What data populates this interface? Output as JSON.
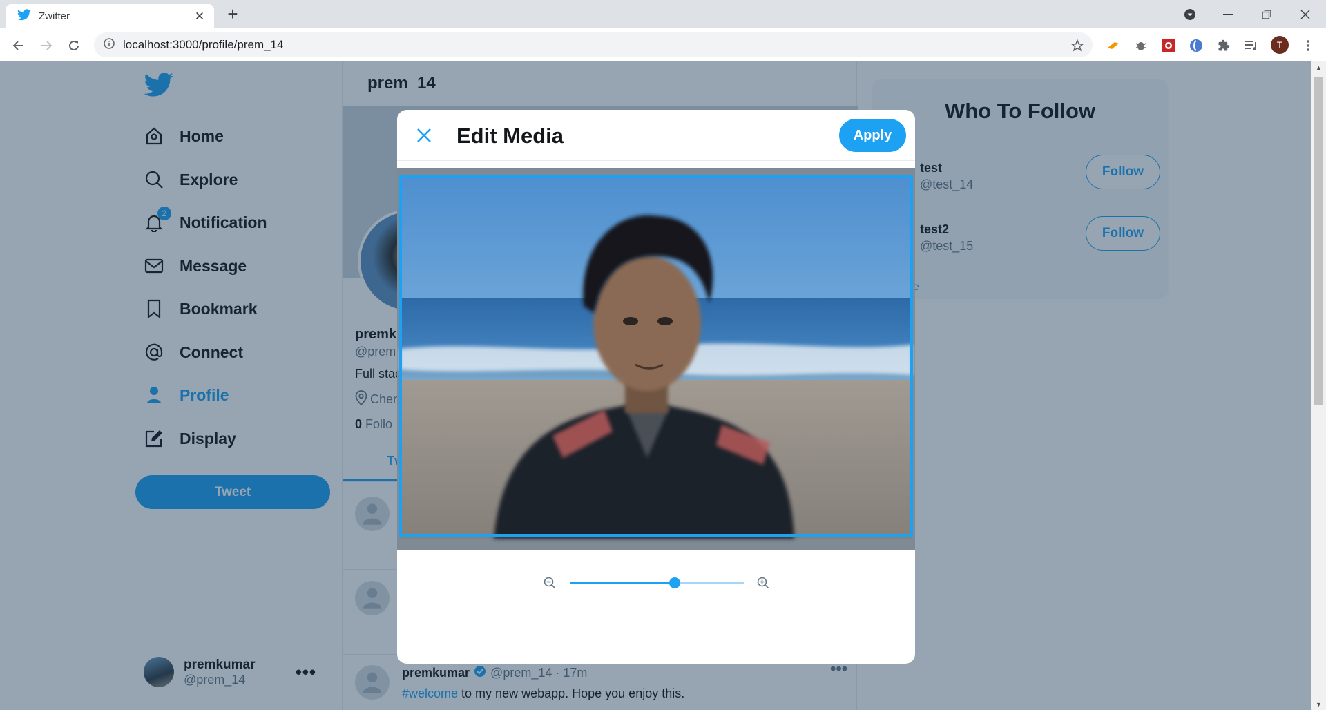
{
  "browser": {
    "tab_title": "Zwitter",
    "url": "localhost:3000/profile/prem_14",
    "profile_initial": "T"
  },
  "sidebar": {
    "items": [
      {
        "label": "Home",
        "icon": "home-icon"
      },
      {
        "label": "Explore",
        "icon": "search-icon"
      },
      {
        "label": "Notification",
        "icon": "bell-icon",
        "badge": "2"
      },
      {
        "label": "Message",
        "icon": "mail-icon"
      },
      {
        "label": "Bookmark",
        "icon": "bookmark-icon"
      },
      {
        "label": "Connect",
        "icon": "at-icon"
      },
      {
        "label": "Profile",
        "icon": "user-icon",
        "active": true
      },
      {
        "label": "Display",
        "icon": "edit-icon"
      }
    ],
    "tweet_button": "Tweet",
    "user": {
      "name": "premkumar",
      "handle": "@prem_14",
      "more": "•••"
    }
  },
  "profile": {
    "header_title": "prem_14",
    "name_partial": "premk",
    "handle_partial": "@prem",
    "bio_partial": "Full stac",
    "location_partial": "Chen",
    "followers_count": "0",
    "followers_label_partial": "Follo",
    "tab_partial": "Tv"
  },
  "feed": {
    "tweet": {
      "name": "premkumar",
      "handle_time": "@prem_14 · 17m",
      "hashtag": "#welcome",
      "text": " to my new webapp. Hope you enjoy this.",
      "more": "•••"
    }
  },
  "who_to_follow": {
    "title": "Who To Follow",
    "users": [
      {
        "name": "test",
        "handle": "@test_14",
        "button": "Follow"
      },
      {
        "name": "test2",
        "handle": "@test_15",
        "button": "Follow"
      }
    ],
    "show_more_partial": "e"
  },
  "modal": {
    "title": "Edit Media",
    "apply_label": "Apply",
    "zoom_level": 0.6
  },
  "colors": {
    "accent": "#1da1f2",
    "overlay": "rgba(25,55,85,0.45)"
  }
}
